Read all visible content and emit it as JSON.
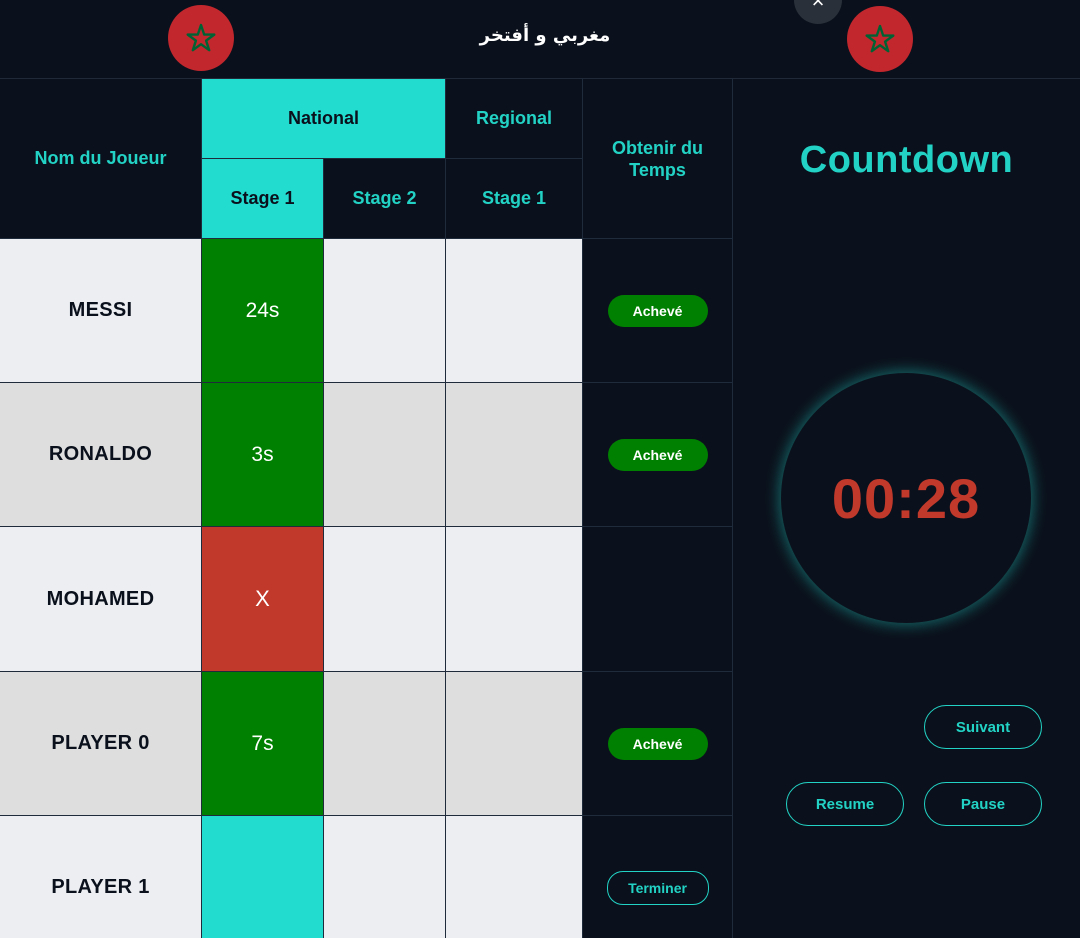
{
  "header": {
    "title": "مغربي و أفتخر",
    "close_label": "×",
    "flag_icons": [
      "morocco-flag-icon",
      "morocco-flag-icon"
    ]
  },
  "table": {
    "headers": {
      "player_name": "Nom du Joueur",
      "national": "National",
      "regional": "Regional",
      "get_time": "Obtenir du Temps",
      "stages": [
        "Stage 1",
        "Stage 2",
        "Stage 1"
      ]
    },
    "rows": [
      {
        "name": "MESSI",
        "stage1": "24s",
        "stage1_status": "success",
        "stage2": "",
        "regional1": "",
        "action": "Achevé"
      },
      {
        "name": "RONALDO",
        "stage1": "3s",
        "stage1_status": "success",
        "stage2": "",
        "regional1": "",
        "action": "Achevé"
      },
      {
        "name": "MOHAMED",
        "stage1": "X",
        "stage1_status": "fail",
        "stage2": "",
        "regional1": "",
        "action": ""
      },
      {
        "name": "PLAYER 0",
        "stage1": "7s",
        "stage1_status": "success",
        "stage2": "",
        "regional1": "",
        "action": "Achevé"
      },
      {
        "name": "PLAYER 1",
        "stage1": "",
        "stage1_status": "active",
        "stage2": "",
        "regional1": "",
        "action": "Terminer"
      }
    ]
  },
  "countdown": {
    "title": "Countdown",
    "time": "00:28",
    "buttons": {
      "next": "Suivant",
      "resume": "Resume",
      "pause": "Pause"
    }
  },
  "colors": {
    "background": "#0b111c",
    "accent": "#22d3c5",
    "success": "#008000",
    "fail": "#c0392b",
    "flag_red": "#c1272d",
    "flag_star": "#006233"
  }
}
